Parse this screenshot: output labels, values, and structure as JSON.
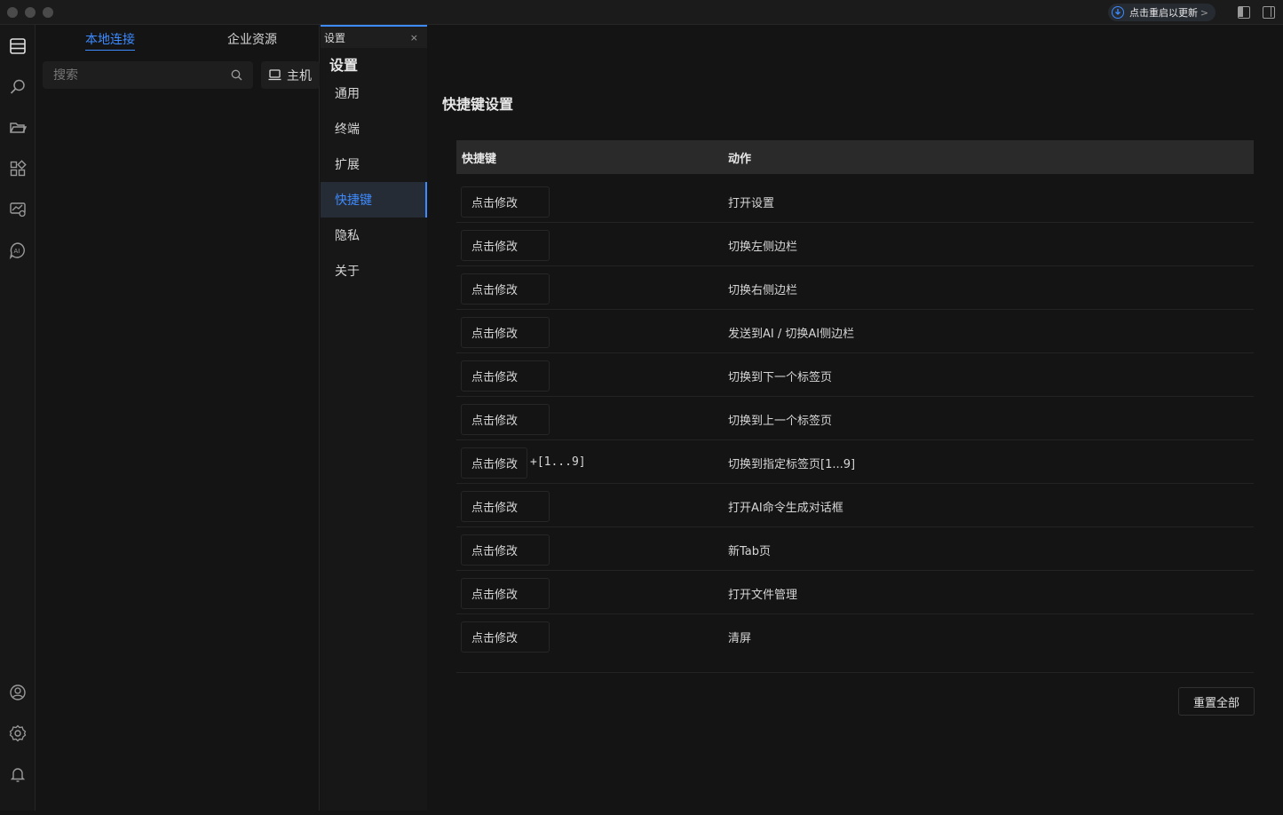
{
  "titlebar": {
    "update_label": "点击重启以更新"
  },
  "left_panel": {
    "tabs": [
      {
        "label": "本地连接",
        "active": true
      },
      {
        "label": "企业资源",
        "active": false
      }
    ],
    "search": {
      "placeholder": "搜索",
      "value": ""
    },
    "host_button": "主机"
  },
  "tab": {
    "label": "设置",
    "close": "×"
  },
  "settings_nav": {
    "title": "设置",
    "items": [
      {
        "label": "通用",
        "active": false
      },
      {
        "label": "终端",
        "active": false
      },
      {
        "label": "扩展",
        "active": false
      },
      {
        "label": "快捷键",
        "active": true
      },
      {
        "label": "隐私",
        "active": false
      },
      {
        "label": "关于",
        "active": false
      }
    ]
  },
  "shortcuts": {
    "title": "快捷键设置",
    "columns": {
      "key": "快捷键",
      "action": "动作"
    },
    "rows": [
      {
        "key": "点击修改",
        "suffix": "",
        "action": "打开设置"
      },
      {
        "key": "点击修改",
        "suffix": "",
        "action": "切换左侧边栏"
      },
      {
        "key": "点击修改",
        "suffix": "",
        "action": "切换右侧边栏"
      },
      {
        "key": "点击修改",
        "suffix": "",
        "action": "发送到AI / 切换AI侧边栏"
      },
      {
        "key": "点击修改",
        "suffix": "",
        "action": "切换到下一个标签页"
      },
      {
        "key": "点击修改",
        "suffix": "",
        "action": "切换到上一个标签页"
      },
      {
        "key": "点击修改",
        "suffix": "+[1...9]",
        "action": "切换到指定标签页[1...9]"
      },
      {
        "key": "点击修改",
        "suffix": "",
        "action": "打开AI命令生成对话框"
      },
      {
        "key": "点击修改",
        "suffix": "",
        "action": "新Tab页"
      },
      {
        "key": "点击修改",
        "suffix": "",
        "action": "打开文件管理"
      },
      {
        "key": "点击修改",
        "suffix": "",
        "action": "清屏"
      }
    ],
    "reset_label": "重置全部"
  },
  "colors": {
    "accent": "#3d8bff",
    "background": "#141414",
    "header_bg": "#2a2a2a"
  },
  "icons": {
    "rail_top": [
      "server-list-icon",
      "search-icon",
      "folder-icon",
      "apps-icon",
      "monitor-icon",
      "ai-icon"
    ],
    "rail_bottom": [
      "user-icon",
      "gear-icon",
      "bell-icon"
    ]
  }
}
